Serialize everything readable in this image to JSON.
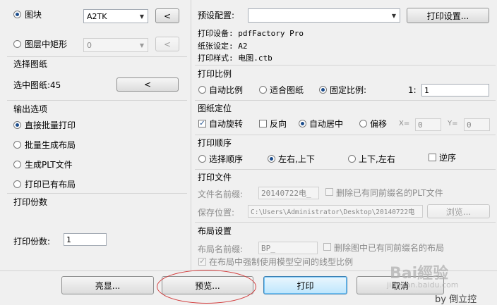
{
  "left": {
    "top_section": {
      "block_label": "图块",
      "block_combo": "A2TK",
      "block_btn": "<",
      "layer_label": "图层中矩形",
      "layer_combo": "0",
      "layer_btn": "<"
    },
    "select_section": {
      "title": "选择图纸",
      "count_label": "选中图纸:45",
      "btn": "<"
    },
    "output_section": {
      "title": "输出选项",
      "options": [
        "直接批量打印",
        "批量生成布局",
        "生成PLT文件",
        "打印已有布局"
      ],
      "selected_index": 0
    },
    "copies_section": {
      "title": "打印份数",
      "label": "打印份数:",
      "value": "1"
    }
  },
  "right": {
    "preset": {
      "label": "预设配置:",
      "combo": "",
      "settings_btn": "打印设置...",
      "device": "打印设备: pdfFactory Pro",
      "paper": "纸张设定: A2",
      "style": "打印样式: 电图.ctb"
    },
    "scale": {
      "title": "打印比例",
      "options": [
        "自动比例",
        "适合图纸",
        "固定比例:"
      ],
      "selected_index": 2,
      "ratio_label": "1:",
      "ratio_value": "1"
    },
    "position": {
      "title": "图纸定位",
      "auto_rotate": "自动旋转",
      "reverse": "反向",
      "auto_center": "自动居中",
      "offset": "偏移",
      "x_label": "X=",
      "x_value": "0",
      "y_label": "Y=",
      "y_value": "0"
    },
    "order": {
      "title": "打印顺序",
      "options": [
        "选择顺序",
        "左右,上下",
        "上下,左右"
      ],
      "selected_index": 1,
      "reverse": "逆序"
    },
    "file": {
      "title": "打印文件",
      "prefix_label": "文件名前缀:",
      "prefix_value": "20140722电_",
      "delete_label": "删除已有同前缀名的PLT文件",
      "save_label": "保存位置:",
      "save_value": "C:\\Users\\Administrator\\Desktop\\20140722电",
      "browse_btn": "浏览..."
    },
    "layout": {
      "title": "布局设置",
      "prefix_label": "布局名前缀:",
      "prefix_value": "BP_",
      "delete_label": "删除图中已有同前缀名的布局",
      "force_label": "在布局中强制使用模型空间的线型比例"
    }
  },
  "footer": {
    "highlight": "亮显...",
    "preview": "预览...",
    "print": "打印",
    "cancel": "取消"
  },
  "watermark": {
    "brand": "Bai經验",
    "url": "jingyan.baidu.com",
    "by": "by 倒立控"
  },
  "colors": {
    "annotation": "#d23a3a",
    "accent": "#1c4d8c"
  }
}
